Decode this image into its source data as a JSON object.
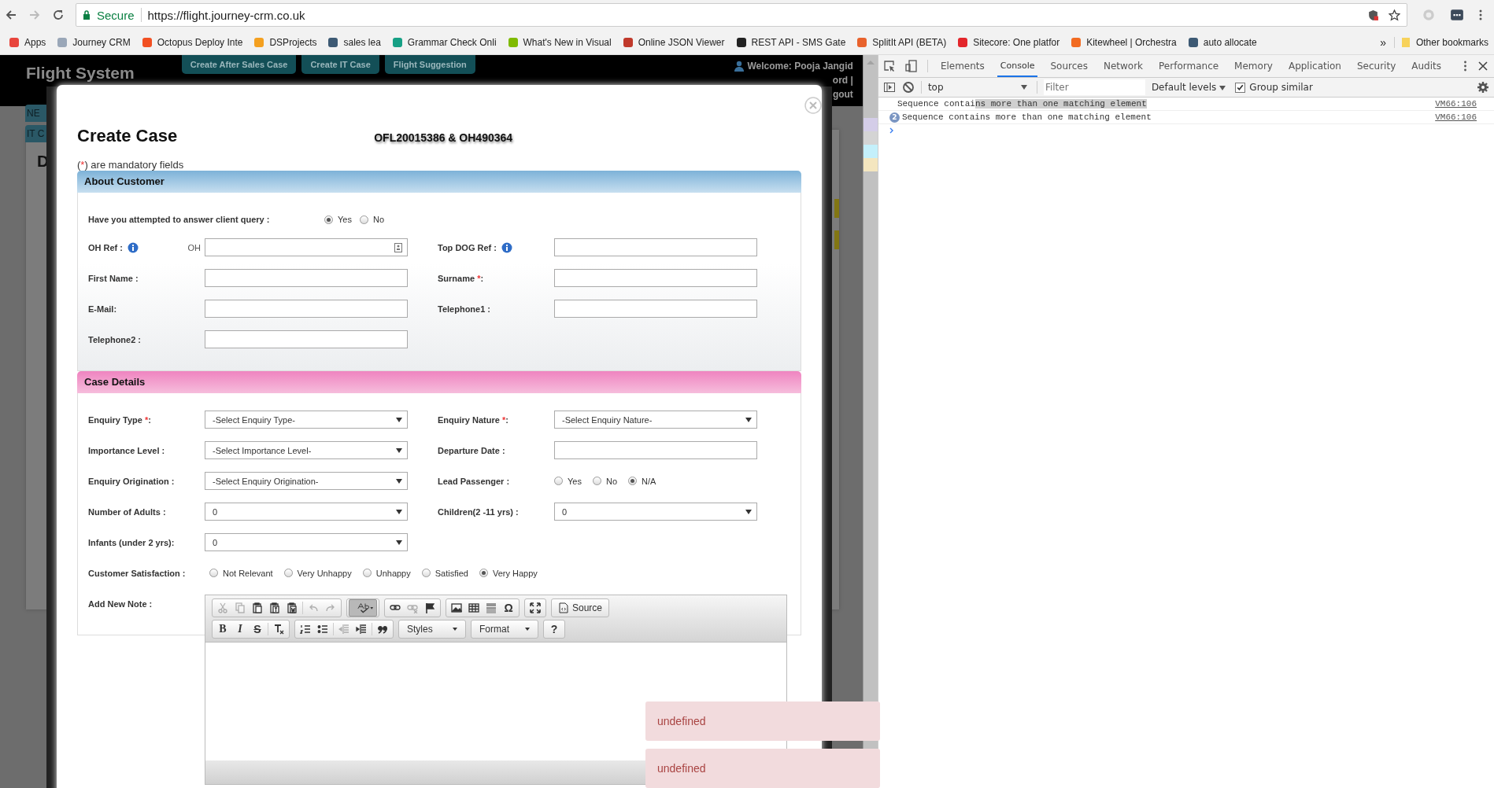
{
  "browser": {
    "secure_label": "Secure",
    "url": "https://flight.journey-crm.co.uk"
  },
  "bookmarks": [
    {
      "label": "Apps",
      "color": "#e8453c"
    },
    {
      "label": "Journey CRM",
      "color": "#9aa7b8"
    },
    {
      "label": "Octopus Deploy Inte",
      "color": "#f25022"
    },
    {
      "label": "DSProjects",
      "color": "#f4a020"
    },
    {
      "label": "sales lea",
      "color": "#3d5a74"
    },
    {
      "label": "Grammar Check Onli",
      "color": "#16a085"
    },
    {
      "label": "What's New in Visual",
      "color": "#7fba00"
    },
    {
      "label": "Online JSON Viewer",
      "color": "#c0392b"
    },
    {
      "label": "REST API - SMS Gate",
      "color": "#222222"
    },
    {
      "label": "SplitIt API (BETA)",
      "color": "#e8622c"
    },
    {
      "label": "Sitecore: One platfor",
      "color": "#e3262b"
    },
    {
      "label": "Kitewheel | Orchestra",
      "color": "#f26b21"
    },
    {
      "label": "auto allocate",
      "color": "#3d5a74"
    }
  ],
  "bookmarks_overflow": "»",
  "other_bookmarks": "Other bookmarks",
  "app": {
    "title": "Flight System",
    "nav": [
      "Create After Sales Case",
      "Create IT Case",
      "Flight Suggestion"
    ],
    "welcome": "Welcome: Pooja Jangid",
    "header_fragments": [
      "ord |",
      "gout"
    ],
    "background_tabs": [
      "NE",
      "IT C"
    ],
    "background_heading": "D"
  },
  "modal": {
    "title": "Create Case",
    "reference": "OFL20015386  & OH490364",
    "mandatory_note": [
      {
        "kind": "plain",
        "text": "("
      },
      {
        "kind": "required",
        "text": "*"
      },
      {
        "kind": "plain",
        "text": ") are mandatory fields"
      }
    ],
    "question": {
      "label": "Have you attempted to answer client query :",
      "options": [
        {
          "label": "Yes",
          "selected": true
        },
        {
          "label": "No",
          "selected": false
        }
      ]
    },
    "sections": [
      {
        "title": "About Customer",
        "kind": "customer",
        "rows": [
          [
            {
              "kind": "text",
              "label": "OH Ref :",
              "info": true,
              "prefix": "OH",
              "picker": true
            },
            {
              "kind": "text",
              "label": "Top DOG Ref :",
              "info": true
            }
          ],
          [
            {
              "kind": "text",
              "label": "First Name :"
            },
            {
              "kind": "text",
              "label": "Surname ",
              "required": "*",
              "label_end": ":"
            }
          ],
          [
            {
              "kind": "text",
              "label": "E-Mail:"
            },
            {
              "kind": "text",
              "label": "Telephone1 :"
            }
          ],
          [
            {
              "kind": "text",
              "label": "Telephone2 :"
            }
          ]
        ]
      },
      {
        "title": "Case Details",
        "kind": "case",
        "rows": [
          [
            {
              "kind": "select",
              "label": "Enquiry Type ",
              "required": "*",
              "label_end": ":",
              "value": "-Select Enquiry Type-"
            },
            {
              "kind": "select",
              "label": "Enquiry Nature ",
              "required": "*",
              "label_end": ":",
              "value": "-Select Enquiry Nature-"
            }
          ],
          [
            {
              "kind": "select",
              "label": "Importance Level :",
              "value": "-Select Importance Level-"
            },
            {
              "kind": "text",
              "label": "Departure Date :"
            }
          ],
          [
            {
              "kind": "select",
              "label": "Enquiry Origination :",
              "value": "-Select Enquiry Origination-"
            },
            {
              "kind": "radio",
              "label": "Lead Passenger :",
              "options": [
                {
                  "label": "Yes",
                  "selected": false
                },
                {
                  "label": "No",
                  "selected": false
                },
                {
                  "label": "N/A",
                  "selected": true
                }
              ]
            }
          ],
          [
            {
              "kind": "select",
              "label": "Number of Adults :",
              "value": "0"
            },
            {
              "kind": "select",
              "label": "Children(2 -11 yrs) :",
              "value": "0"
            }
          ],
          [
            {
              "kind": "select",
              "label": "Infants (under 2 yrs):",
              "value": "0"
            }
          ],
          [
            {
              "kind": "wideradio",
              "label": "Customer Satisfaction :",
              "options": [
                {
                  "label": "Not Relevant",
                  "selected": false
                },
                {
                  "label": "Very Unhappy",
                  "selected": false
                },
                {
                  "label": "Unhappy",
                  "selected": false
                },
                {
                  "label": "Satisfied",
                  "selected": false
                },
                {
                  "label": "Very Happy",
                  "selected": true
                }
              ]
            }
          ],
          [
            {
              "kind": "editor",
              "label": "Add New Note :"
            }
          ]
        ]
      }
    ],
    "toolbar_rows": [
      [
        [
          {
            "kind": "cut",
            "disabled": true
          },
          {
            "kind": "copy",
            "disabled": true
          },
          {
            "kind": "paste",
            "disabled": false
          },
          {
            "kind": "pastetext",
            "disabled": false
          },
          {
            "kind": "pasteword",
            "disabled": false
          },
          {
            "kind": "separator"
          },
          {
            "kind": "undo",
            "disabled": true
          },
          {
            "kind": "redo",
            "disabled": true
          }
        ],
        [
          {
            "kind": "spellcheck",
            "active": true
          }
        ],
        [
          {
            "kind": "link",
            "disabled": false
          },
          {
            "kind": "unlink",
            "disabled": true
          },
          {
            "kind": "anchor",
            "disabled": false
          }
        ],
        [
          {
            "kind": "image",
            "disabled": false
          },
          {
            "kind": "table",
            "disabled": false
          },
          {
            "kind": "rule",
            "disabled": false
          },
          {
            "kind": "char",
            "label": "Ω"
          }
        ],
        [
          {
            "kind": "maximize",
            "disabled": false
          }
        ],
        [
          {
            "kind": "source",
            "label": "Source"
          }
        ]
      ],
      [
        [
          {
            "kind": "bold",
            "label": "B"
          },
          {
            "kind": "italic",
            "label": "I"
          },
          {
            "kind": "strike",
            "label": "S"
          },
          {
            "kind": "separator"
          },
          {
            "kind": "clearformat",
            "disabled": false
          }
        ],
        [
          {
            "kind": "numbered",
            "disabled": false
          },
          {
            "kind": "bulleted",
            "disabled": false
          },
          {
            "kind": "separator"
          },
          {
            "kind": "outdent",
            "disabled": true
          },
          {
            "kind": "indent",
            "disabled": false
          },
          {
            "kind": "separator"
          },
          {
            "kind": "quote",
            "disabled": false
          }
        ],
        [
          {
            "kind": "dropdown",
            "label": "Styles"
          }
        ],
        [
          {
            "kind": "dropdown",
            "label": "Format"
          }
        ],
        [
          {
            "kind": "char",
            "label": "?"
          }
        ]
      ]
    ]
  },
  "toasts": [
    "undefined",
    "undefined"
  ],
  "devtools": {
    "tabs": [
      {
        "label": "Elements",
        "selected": false
      },
      {
        "label": "Console",
        "selected": true
      },
      {
        "label": "Sources",
        "selected": false
      },
      {
        "label": "Network",
        "selected": false
      },
      {
        "label": "Performance",
        "selected": false
      },
      {
        "label": "Memory",
        "selected": false
      },
      {
        "label": "Application",
        "selected": false
      },
      {
        "label": "Security",
        "selected": false
      },
      {
        "label": "Audits",
        "selected": false
      }
    ],
    "context": "top",
    "filter_placeholder": "Filter",
    "levels": "Default levels",
    "group_similar": {
      "label": "Group similar",
      "checked": true
    },
    "messages": [
      {
        "text": "Sequence contai",
        "highlighted": "ns more than one matching element",
        "source": "VM66:106"
      },
      {
        "count": "2",
        "text": "Sequence contains more than one matching element",
        "source": "VM66:106"
      }
    ]
  }
}
